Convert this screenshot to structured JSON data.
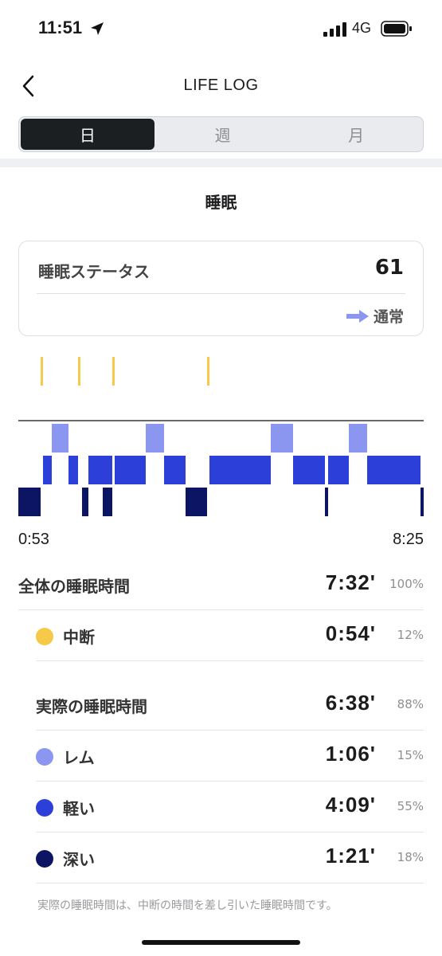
{
  "status": {
    "time": "11:51",
    "network": "4G"
  },
  "header": {
    "title": "LIFE LOG"
  },
  "tabs": [
    {
      "label": "日"
    },
    {
      "label": "週"
    },
    {
      "label": "月"
    }
  ],
  "section": {
    "title": "睡眠"
  },
  "card": {
    "label": "睡眠ステータス",
    "value": "61",
    "trend": "通常"
  },
  "chart_data": {
    "type": "bar",
    "x_start": "0:53",
    "x_end": "8:25",
    "stages": [
      "中断",
      "レム",
      "軽い",
      "深い"
    ],
    "colors": {
      "中断": "#f7c948",
      "レム": "#8a96f0",
      "軽い": "#2d3fd9",
      "深い": "#0b1563"
    },
    "segments": [
      {
        "stage": "深い",
        "from": 0,
        "to": 28
      },
      {
        "stage": "中断",
        "from": 28,
        "to": 31
      },
      {
        "stage": "軽い",
        "from": 31,
        "to": 42
      },
      {
        "stage": "レム",
        "from": 42,
        "to": 63
      },
      {
        "stage": "軽い",
        "from": 63,
        "to": 75
      },
      {
        "stage": "中断",
        "from": 75,
        "to": 78
      },
      {
        "stage": "深い",
        "from": 80,
        "to": 88
      },
      {
        "stage": "軽い",
        "from": 88,
        "to": 118
      },
      {
        "stage": "深い",
        "from": 106,
        "to": 118
      },
      {
        "stage": "中断",
        "from": 118,
        "to": 121
      },
      {
        "stage": "軽い",
        "from": 121,
        "to": 160
      },
      {
        "stage": "レム",
        "from": 160,
        "to": 183
      },
      {
        "stage": "軽い",
        "from": 183,
        "to": 210
      },
      {
        "stage": "深い",
        "from": 210,
        "to": 237
      },
      {
        "stage": "中断",
        "from": 237,
        "to": 240
      },
      {
        "stage": "軽い",
        "from": 240,
        "to": 317
      },
      {
        "stage": "レム",
        "from": 317,
        "to": 345
      },
      {
        "stage": "軽い",
        "from": 345,
        "to": 385
      },
      {
        "stage": "深い",
        "from": 385,
        "to": 389
      },
      {
        "stage": "軽い",
        "from": 389,
        "to": 415
      },
      {
        "stage": "レム",
        "from": 415,
        "to": 438
      },
      {
        "stage": "軽い",
        "from": 438,
        "to": 505
      },
      {
        "stage": "深い",
        "from": 505,
        "to": 509
      }
    ]
  },
  "summary": {
    "total": {
      "label": "全体の睡眠時間",
      "value": "7:32'",
      "pct": "100%"
    },
    "interrupt": {
      "label": "中断",
      "value": "0:54'",
      "pct": "12%"
    },
    "actual": {
      "label": "実際の睡眠時間",
      "value": "6:38'",
      "pct": "88%"
    },
    "rem": {
      "label": "レム",
      "value": "1:06'",
      "pct": "15%"
    },
    "light": {
      "label": "軽い",
      "value": "4:09'",
      "pct": "55%"
    },
    "deep": {
      "label": "深い",
      "value": "1:21'",
      "pct": "18%"
    }
  },
  "footnote": "実際の睡眠時間は、中断の時間を差し引いた睡眠時間です。"
}
